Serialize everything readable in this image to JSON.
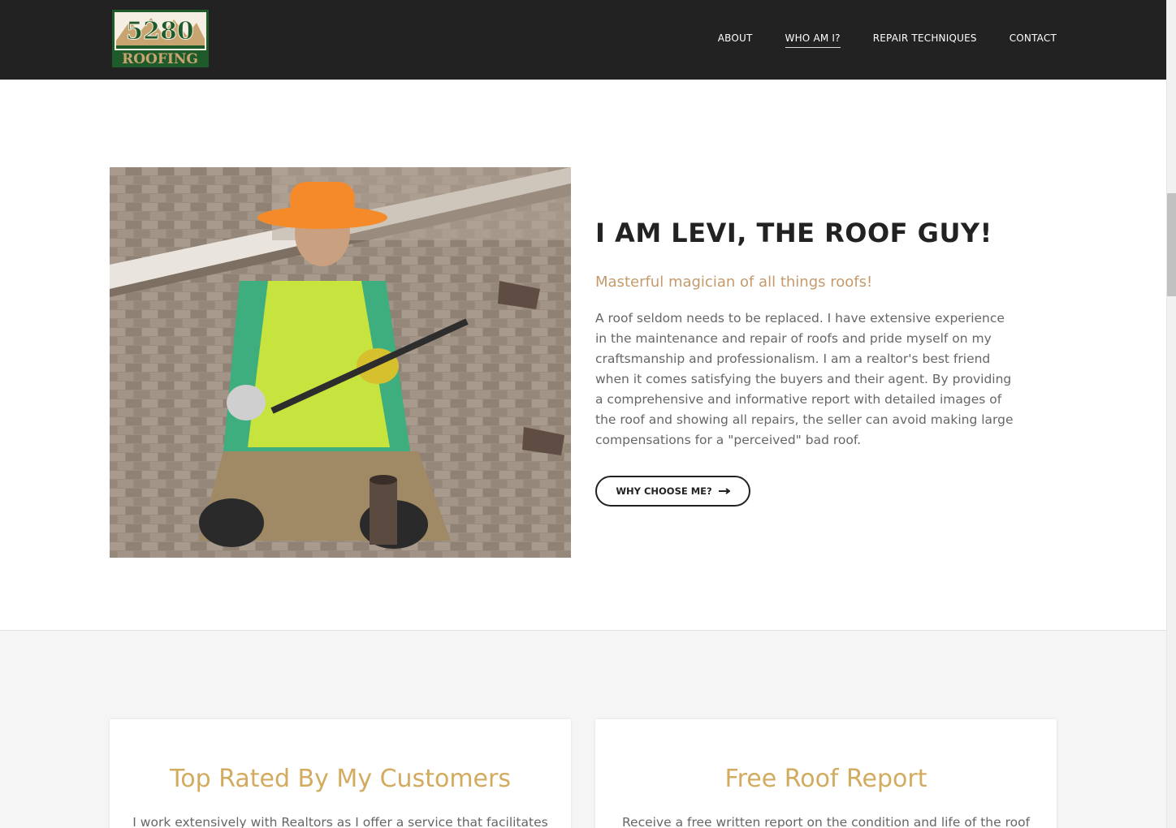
{
  "header": {
    "logo_text_top": "5280",
    "logo_text_bottom": "ROOFING",
    "nav": [
      "ABOUT",
      "WHO AM I?",
      "REPAIR TECHNIQUES",
      "CONTACT"
    ],
    "active_nav": "WHO AM I?"
  },
  "hero": {
    "title": "I AM LEVI, THE ROOF GUY!",
    "subtitle": "Masterful magician of all things roofs!",
    "body": "A roof seldom needs to be replaced. I have extensive experience in the maintenance and repair of roofs and pride myself on my craftsmanship and professionalism. I am a realtor's best friend when it comes satisfying the buyers and their agent. By providing a comprehensive and informative report with detailed images of the roof and showing all repairs, the seller can avoid making large compensations for a \"perceived\" bad roof.",
    "button_label": "WHY CHOOSE ME?",
    "button_icon": "arrow-right-icon"
  },
  "cards": [
    {
      "title": "Top Rated By My Customers",
      "text": "I work extensively with Realtors as I offer a service that facilitates"
    },
    {
      "title": "Free Roof Report",
      "text": "Receive a free written report on the condition and life of the roof"
    }
  ],
  "colors": {
    "header_bg": "#222222",
    "accent_subtitle": "#c49a6c",
    "accent_card_title": "#d2ab5e",
    "logo_green": "#1f5a2a",
    "logo_tan": "#c8a570"
  }
}
